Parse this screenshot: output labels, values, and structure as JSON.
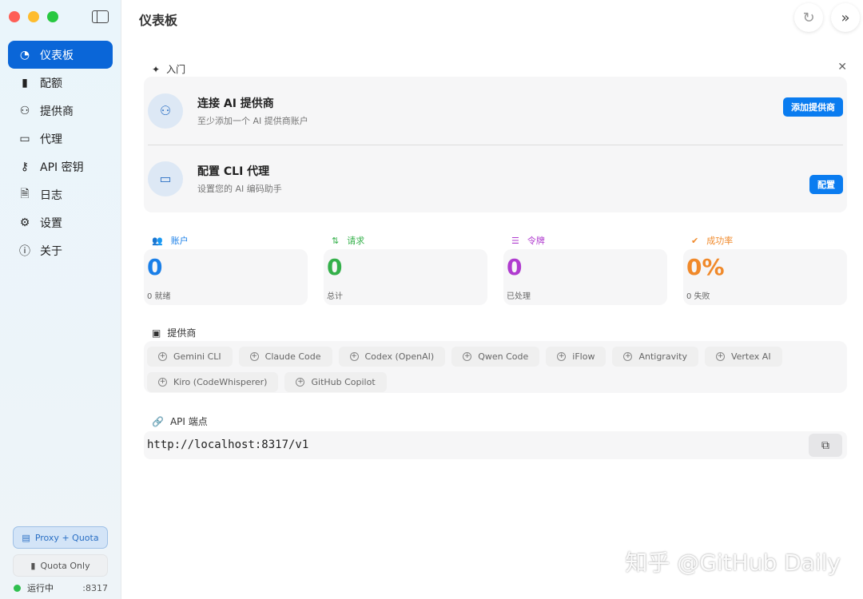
{
  "sidebar": {
    "items": [
      {
        "label": "仪表板",
        "icon": "gauge-icon",
        "glyph": "◔"
      },
      {
        "label": "配额",
        "icon": "bar-chart-icon",
        "glyph": "▮"
      },
      {
        "label": "提供商",
        "icon": "users-key-icon",
        "glyph": "⚇"
      },
      {
        "label": "代理",
        "icon": "terminal-icon",
        "glyph": "▭"
      },
      {
        "label": "API 密钥",
        "icon": "key-icon",
        "glyph": "⚷"
      },
      {
        "label": "日志",
        "icon": "document-icon",
        "glyph": "🗎"
      },
      {
        "label": "设置",
        "icon": "gear-icon",
        "glyph": "⚙"
      },
      {
        "label": "关于",
        "icon": "info-icon",
        "glyph": "ⓘ"
      }
    ],
    "mode_proxy": "Proxy + Quota",
    "mode_quota": "Quota Only",
    "status": "运行中",
    "port": ":8317"
  },
  "header": {
    "title": "仪表板"
  },
  "getting_started": {
    "title": "入门",
    "step1": {
      "title": "连接 AI 提供商",
      "subtitle": "至少添加一个 AI 提供商账户",
      "button": "添加提供商"
    },
    "step2": {
      "title": "配置 CLI 代理",
      "subtitle": "设置您的 AI 编码助手",
      "button": "配置"
    }
  },
  "stats": [
    {
      "label": "账户",
      "value": "0",
      "sub": "0 就绪",
      "color": "#1a7fe8"
    },
    {
      "label": "请求",
      "value": "0",
      "sub": "总计",
      "color": "#34b04a"
    },
    {
      "label": "令牌",
      "value": "0",
      "sub": "已处理",
      "color": "#b03ccf"
    },
    {
      "label": "成功率",
      "value": "0%",
      "sub": "0 失败",
      "color": "#f0892a"
    }
  ],
  "providers": {
    "title": "提供商",
    "items": [
      "Gemini CLI",
      "Claude Code",
      "Codex (OpenAI)",
      "Qwen Code",
      "iFlow",
      "Antigravity",
      "Vertex AI",
      "Kiro (CodeWhisperer)",
      "GitHub Copilot"
    ]
  },
  "endpoint": {
    "title": "API 端点",
    "url": "http://localhost:8317/v1"
  },
  "watermark": "知乎 @GitHub Daily"
}
